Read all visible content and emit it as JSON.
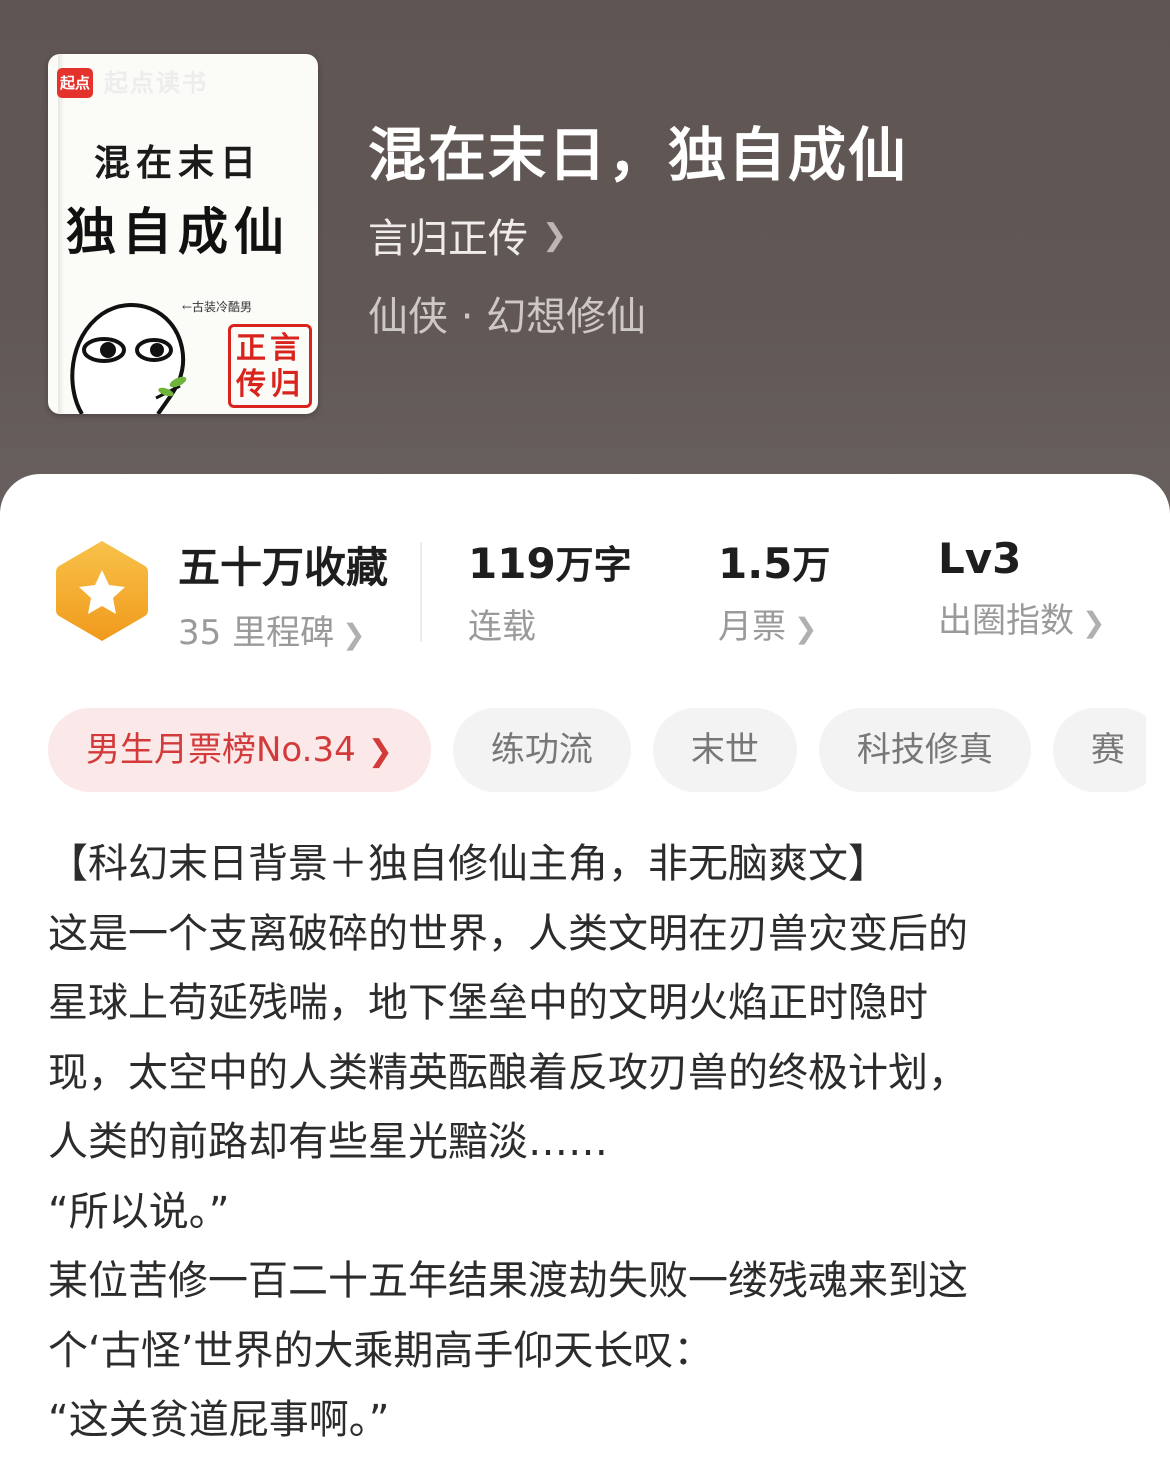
{
  "cover": {
    "logo": "起点",
    "brand": "起点读书",
    "title_line1": "混在末日",
    "title_line2": "独自成仙",
    "caption": "←古装冷酷男",
    "seal": "正言传归"
  },
  "book": {
    "title": "混在末日，独自成仙",
    "author": "言归正传",
    "genre": "仙侠 · 幻想修仙"
  },
  "stats": {
    "favorites": {
      "value": "五十万收藏",
      "sub": "35 里程碑"
    },
    "words": {
      "value": "119",
      "unit": "万字",
      "sub": "连载"
    },
    "tickets": {
      "value": "1.5",
      "unit": "万",
      "sub": "月票"
    },
    "level": {
      "value": "Lv3",
      "sub": "出圈指数"
    }
  },
  "tags": [
    "男生月票榜No.34",
    "练功流",
    "末世",
    "科技修真",
    "赛"
  ],
  "description": [
    "【科幻末日背景＋独自修仙主角，非无脑爽文】",
    "这是一个支离破碎的世界，人类文明在刃兽灾变后的",
    "星球上苟延残喘，地下堡垒中的文明火焰正时隐时",
    "现，太空中的人类精英酝酿着反攻刃兽的终极计划，",
    "人类的前路却有些星光黯淡……",
    "“所以说。”",
    "某位苦修一百二十五年结果渡劫失败一缕残魂来到这",
    "个‘古怪’世界的大乘期高手仰天长叹：",
    "“这关贫道屁事啊。”"
  ],
  "colors": {
    "header_bg": "#615856",
    "badge_orange": "#f5a623",
    "hot_tag_text": "#d33b3b",
    "hot_tag_bg": "#fbe9e9"
  }
}
